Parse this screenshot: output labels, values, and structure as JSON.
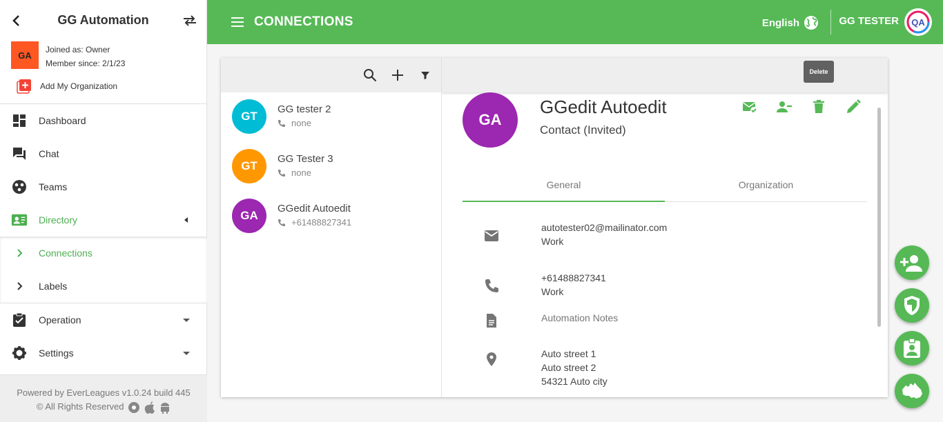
{
  "sidebar": {
    "title": "GG Automation",
    "org_initials": "GA",
    "joined": "Joined as: Owner",
    "member_since": "Member since: 2/1/23",
    "add_org": "Add My Organization",
    "items": [
      {
        "label": "Dashboard",
        "icon": "dashboard-icon"
      },
      {
        "label": "Chat",
        "icon": "chat-icon"
      },
      {
        "label": "Teams",
        "icon": "teams-icon"
      },
      {
        "label": "Directory",
        "icon": "contacts-icon"
      },
      {
        "label": "Connections",
        "icon": "chevron-right-icon"
      },
      {
        "label": "Labels",
        "icon": "chevron-right-icon"
      },
      {
        "label": "Operation",
        "icon": "clipboard-check-icon"
      },
      {
        "label": "Settings",
        "icon": "gear-icon"
      }
    ],
    "footer_line1": "Powered by EverLeagues v1.0.24 build 445",
    "footer_line2": "© All Rights Reserved"
  },
  "topbar": {
    "title": "CONNECTIONS",
    "language": "English",
    "user": "GG TESTER",
    "avatar_text": "QA"
  },
  "contacts": [
    {
      "initials": "GT",
      "name": "GG tester 2",
      "phone": "none",
      "color": "#00bcd4"
    },
    {
      "initials": "GT",
      "name": "GG Tester 3",
      "phone": "none",
      "color": "#ff9800"
    },
    {
      "initials": "GA",
      "name": "GGedit Autoedit",
      "phone": "+61488827341",
      "color": "#9c27b0"
    }
  ],
  "detail": {
    "tooltip": "Delete",
    "initials": "GA",
    "name": "GGedit Autoedit",
    "role": "Contact (Invited)",
    "tabs": [
      "General",
      "Organization"
    ],
    "email": "autotester02@mailinator.com",
    "email_type": "Work",
    "phone": "+61488827341",
    "phone_type": "Work",
    "notes": "Automation Notes",
    "address1": "Auto street 1",
    "address2": "Auto street 2",
    "address3": "54321 Auto city"
  },
  "colors": {
    "accent": "#56b956",
    "org_badge": "#ff5722",
    "detail_avatar": "#9c27b0"
  }
}
